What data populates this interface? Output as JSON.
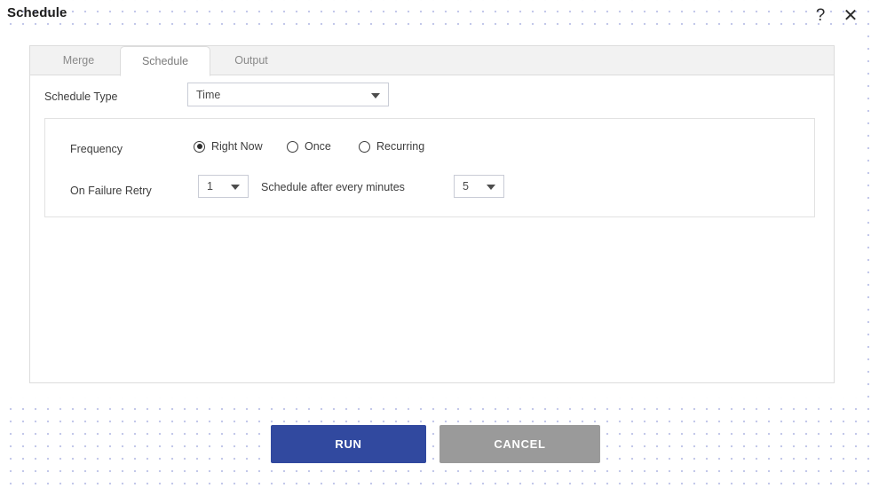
{
  "window": {
    "title": "Schedule",
    "help_icon": "question-mark-icon",
    "help_glyph": "?",
    "close_icon": "close-icon",
    "close_glyph": "✕"
  },
  "tabs": [
    {
      "label": "Merge",
      "active": false
    },
    {
      "label": "Schedule",
      "active": true
    },
    {
      "label": "Output",
      "active": false
    }
  ],
  "form": {
    "schedule_type": {
      "label": "Schedule Type",
      "value": "Time",
      "options": [
        "Time"
      ]
    },
    "frequency": {
      "label": "Frequency",
      "options": [
        {
          "label": "Right Now",
          "selected": true
        },
        {
          "label": "Once",
          "selected": false
        },
        {
          "label": "Recurring",
          "selected": false
        }
      ]
    },
    "on_failure_retry": {
      "label": "On Failure Retry",
      "value": "1",
      "options": [
        "1"
      ]
    },
    "schedule_interval": {
      "label": "Schedule after every minutes",
      "value": "5",
      "options": [
        "5"
      ]
    }
  },
  "footer": {
    "run_label": "RUN",
    "cancel_label": "CANCEL"
  },
  "colors": {
    "run_background": "#31499f",
    "cancel_background": "#9a9a9a",
    "dot_pattern": "#c3c8ea",
    "tab_strip_background": "#f2f2f2",
    "border": "#dcdcdc"
  }
}
